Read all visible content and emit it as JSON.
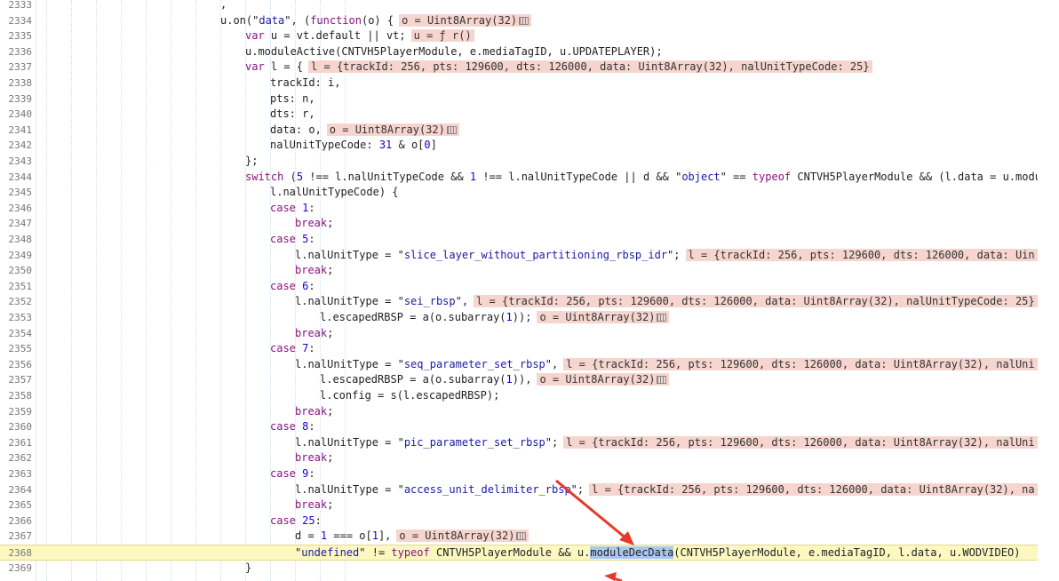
{
  "colors": {
    "keyword": "#881280",
    "string": "#1a1aa6",
    "number": "#1c00cf",
    "inline_value_bg": "#f7d5cf",
    "highlight_line": "#fbf8c0",
    "selection": "#a9c8ef",
    "annotation_arrow": "#e53a2a"
  },
  "annotations": [
    {
      "type": "arrow",
      "color": "red",
      "target": "moduleDecData"
    },
    {
      "type": "arrow",
      "color": "red",
      "target": "moduleDecData"
    }
  ],
  "lines": [
    {
      "n": "2333",
      "ind": 0,
      "tokens": [
        {
          "t": ","
        }
      ]
    },
    {
      "n": "2334",
      "ind": 0,
      "tokens": [
        {
          "t": "u.on(\""
        },
        {
          "t": "data",
          "c": "str"
        },
        {
          "t": "\", ("
        },
        {
          "t": "function",
          "c": "kw"
        },
        {
          "t": "(o) {"
        }
      ],
      "inline": "o = Uint8Array(32)",
      "icon": true
    },
    {
      "n": "2335",
      "ind": 1,
      "tokens": [
        {
          "t": "var",
          "c": "kw"
        },
        {
          "t": " u = vt.default || vt;"
        }
      ],
      "inline": "u = ƒ r()"
    },
    {
      "n": "2336",
      "ind": 1,
      "tokens": [
        {
          "t": "u.moduleActive(CNTVH5PlayerModule, e.mediaTagID, u.UPDATEPLAYER);"
        }
      ]
    },
    {
      "n": "2337",
      "ind": 1,
      "tokens": [
        {
          "t": "var",
          "c": "kw"
        },
        {
          "t": " l = {"
        }
      ],
      "inline": "l = {trackId: 256, pts: 129600, dts: 126000, data: Uint8Array(32), nalUnitTypeCode: 25}"
    },
    {
      "n": "2338",
      "ind": 2,
      "tokens": [
        {
          "t": "trackId: i,"
        }
      ]
    },
    {
      "n": "2339",
      "ind": 2,
      "tokens": [
        {
          "t": "pts: n,"
        }
      ]
    },
    {
      "n": "2340",
      "ind": 2,
      "tokens": [
        {
          "t": "dts: r,"
        }
      ]
    },
    {
      "n": "2341",
      "ind": 2,
      "tokens": [
        {
          "t": "data: o,"
        }
      ],
      "inline": "o = Uint8Array(32)",
      "icon": true
    },
    {
      "n": "2342",
      "ind": 2,
      "tokens": [
        {
          "t": "nalUnitTypeCode: "
        },
        {
          "t": "31",
          "c": "num"
        },
        {
          "t": " & o["
        },
        {
          "t": "0",
          "c": "num"
        },
        {
          "t": "]"
        }
      ]
    },
    {
      "n": "2343",
      "ind": 1,
      "tokens": [
        {
          "t": "};"
        }
      ]
    },
    {
      "n": "2344",
      "ind": 1,
      "tokens": [
        {
          "t": "switch",
          "c": "kw"
        },
        {
          "t": " ("
        },
        {
          "t": "5",
          "c": "num"
        },
        {
          "t": " !== l.nalUnitTypeCode && "
        },
        {
          "t": "1",
          "c": "num"
        },
        {
          "t": " !== l.nalUnitTypeCode || d && \""
        },
        {
          "t": "object",
          "c": "str"
        },
        {
          "t": "\" == "
        },
        {
          "t": "typeof",
          "c": "kw"
        },
        {
          "t": " CNTVH5PlayerModule && (l.data = u.modu"
        }
      ]
    },
    {
      "n": "2345",
      "ind": 2,
      "tokens": [
        {
          "t": "l.nalUnitTypeCode) {"
        }
      ]
    },
    {
      "n": "2346",
      "ind": 2,
      "tokens": [
        {
          "t": "case",
          "c": "kw"
        },
        {
          "t": " "
        },
        {
          "t": "1",
          "c": "num"
        },
        {
          "t": ":"
        }
      ]
    },
    {
      "n": "2347",
      "ind": 3,
      "tokens": [
        {
          "t": "break",
          "c": "kw"
        },
        {
          "t": ";"
        }
      ]
    },
    {
      "n": "2348",
      "ind": 2,
      "tokens": [
        {
          "t": "case",
          "c": "kw"
        },
        {
          "t": " "
        },
        {
          "t": "5",
          "c": "num"
        },
        {
          "t": ":"
        }
      ]
    },
    {
      "n": "2349",
      "ind": 3,
      "tokens": [
        {
          "t": "l.nalUnitType = \""
        },
        {
          "t": "slice_layer_without_partitioning_rbsp_idr",
          "c": "str"
        },
        {
          "t": "\";"
        }
      ],
      "inline": "l = {trackId: 256, pts: 129600, dts: 126000, data: Uin"
    },
    {
      "n": "2350",
      "ind": 3,
      "tokens": [
        {
          "t": "break",
          "c": "kw"
        },
        {
          "t": ";"
        }
      ]
    },
    {
      "n": "2351",
      "ind": 2,
      "tokens": [
        {
          "t": "case",
          "c": "kw"
        },
        {
          "t": " "
        },
        {
          "t": "6",
          "c": "num"
        },
        {
          "t": ":"
        }
      ]
    },
    {
      "n": "2352",
      "ind": 3,
      "tokens": [
        {
          "t": "l.nalUnitType = \""
        },
        {
          "t": "sei_rbsp",
          "c": "str"
        },
        {
          "t": "\","
        }
      ],
      "inline": "l = {trackId: 256, pts: 129600, dts: 126000, data: Uint8Array(32), nalUnitTypeCode: 25}"
    },
    {
      "n": "2353",
      "ind": 4,
      "tokens": [
        {
          "t": "l.escapedRBSP = a(o.subarray("
        },
        {
          "t": "1",
          "c": "num"
        },
        {
          "t": "));"
        }
      ],
      "inline": "o = Uint8Array(32)",
      "icon": true
    },
    {
      "n": "2354",
      "ind": 3,
      "tokens": [
        {
          "t": "break",
          "c": "kw"
        },
        {
          "t": ";"
        }
      ]
    },
    {
      "n": "2355",
      "ind": 2,
      "tokens": [
        {
          "t": "case",
          "c": "kw"
        },
        {
          "t": " "
        },
        {
          "t": "7",
          "c": "num"
        },
        {
          "t": ":"
        }
      ]
    },
    {
      "n": "2356",
      "ind": 3,
      "tokens": [
        {
          "t": "l.nalUnitType = \""
        },
        {
          "t": "seq_parameter_set_rbsp",
          "c": "str"
        },
        {
          "t": "\","
        }
      ],
      "inline": "l = {trackId: 256, pts: 129600, dts: 126000, data: Uint8Array(32), nalUni"
    },
    {
      "n": "2357",
      "ind": 4,
      "tokens": [
        {
          "t": "l.escapedRBSP = a(o.subarray("
        },
        {
          "t": "1",
          "c": "num"
        },
        {
          "t": ")),"
        }
      ],
      "inline": "o = Uint8Array(32)",
      "icon": true
    },
    {
      "n": "2358",
      "ind": 4,
      "tokens": [
        {
          "t": "l.config = s(l.escapedRBSP);"
        }
      ]
    },
    {
      "n": "2359",
      "ind": 3,
      "tokens": [
        {
          "t": "break",
          "c": "kw"
        },
        {
          "t": ";"
        }
      ]
    },
    {
      "n": "2360",
      "ind": 2,
      "tokens": [
        {
          "t": "case",
          "c": "kw"
        },
        {
          "t": " "
        },
        {
          "t": "8",
          "c": "num"
        },
        {
          "t": ":"
        }
      ]
    },
    {
      "n": "2361",
      "ind": 3,
      "tokens": [
        {
          "t": "l.nalUnitType = \""
        },
        {
          "t": "pic_parameter_set_rbsp",
          "c": "str"
        },
        {
          "t": "\";"
        }
      ],
      "inline": "l = {trackId: 256, pts: 129600, dts: 126000, data: Uint8Array(32), nalUni"
    },
    {
      "n": "2362",
      "ind": 3,
      "tokens": [
        {
          "t": "break",
          "c": "kw"
        },
        {
          "t": ";"
        }
      ]
    },
    {
      "n": "2363",
      "ind": 2,
      "tokens": [
        {
          "t": "case",
          "c": "kw"
        },
        {
          "t": " "
        },
        {
          "t": "9",
          "c": "num"
        },
        {
          "t": ":"
        }
      ]
    },
    {
      "n": "2364",
      "ind": 3,
      "tokens": [
        {
          "t": "l.nalUnitType = \""
        },
        {
          "t": "access_unit_delimiter_rbsp",
          "c": "str"
        },
        {
          "t": "\";"
        }
      ],
      "inline": "l = {trackId: 256, pts: 129600, dts: 126000, data: Uint8Array(32), na"
    },
    {
      "n": "2365",
      "ind": 3,
      "tokens": [
        {
          "t": "break",
          "c": "kw"
        },
        {
          "t": ";"
        }
      ]
    },
    {
      "n": "2366",
      "ind": 2,
      "tokens": [
        {
          "t": "case",
          "c": "kw"
        },
        {
          "t": " "
        },
        {
          "t": "25",
          "c": "num"
        },
        {
          "t": ":"
        }
      ]
    },
    {
      "n": "2367",
      "ind": 3,
      "tokens": [
        {
          "t": "d = "
        },
        {
          "t": "1",
          "c": "num"
        },
        {
          "t": " === o["
        },
        {
          "t": "1",
          "c": "num"
        },
        {
          "t": "],"
        }
      ],
      "inline": "o = Uint8Array(32)",
      "icon": true
    },
    {
      "n": "2368",
      "ind": 3,
      "hl": true,
      "tokens": [
        {
          "t": "\""
        },
        {
          "t": "undefined",
          "c": "str"
        },
        {
          "t": "\" != "
        },
        {
          "t": "typeof",
          "c": "kw"
        },
        {
          "t": " CNTVH5PlayerModule && u."
        },
        {
          "t": "moduleDecData",
          "c": "sel"
        },
        {
          "t": "(CNTVH5PlayerModule, e.mediaTagID, l.data, u.WODVIDEO)"
        }
      ]
    },
    {
      "n": "2369",
      "ind": 1,
      "tokens": [
        {
          "t": "}"
        }
      ]
    }
  ]
}
